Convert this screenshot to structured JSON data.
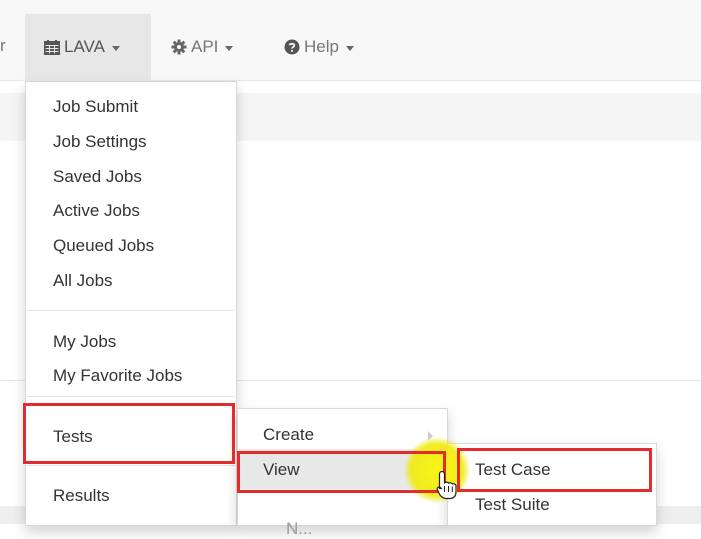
{
  "navbar": {
    "left_fragment": "r",
    "items": [
      {
        "label": "LAVA",
        "icon": "calendar-icon",
        "active": true
      },
      {
        "label": "API",
        "icon": "gear-icon",
        "active": false
      },
      {
        "label": "Help",
        "icon": "question-circle-icon",
        "active": false
      }
    ]
  },
  "lava_menu": {
    "items": [
      "Job Submit",
      "Job Settings",
      "Saved Jobs",
      "Active Jobs",
      "Queued Jobs",
      "All Jobs",
      "My Jobs",
      "My Favorite Jobs",
      "Tests",
      "Results"
    ]
  },
  "tests_submenu": {
    "items": [
      "Create",
      "View",
      "N..."
    ]
  },
  "view_submenu": {
    "items": [
      "Test Case",
      "Test Suite"
    ]
  },
  "colors": {
    "navbar_bg": "#f8f8f8",
    "active_nav_bg": "#e7e7e7",
    "highlight_box": "#e52b2b",
    "cursor_highlight": "#f5f010",
    "hover_item_bg": "#e8e8e8"
  }
}
